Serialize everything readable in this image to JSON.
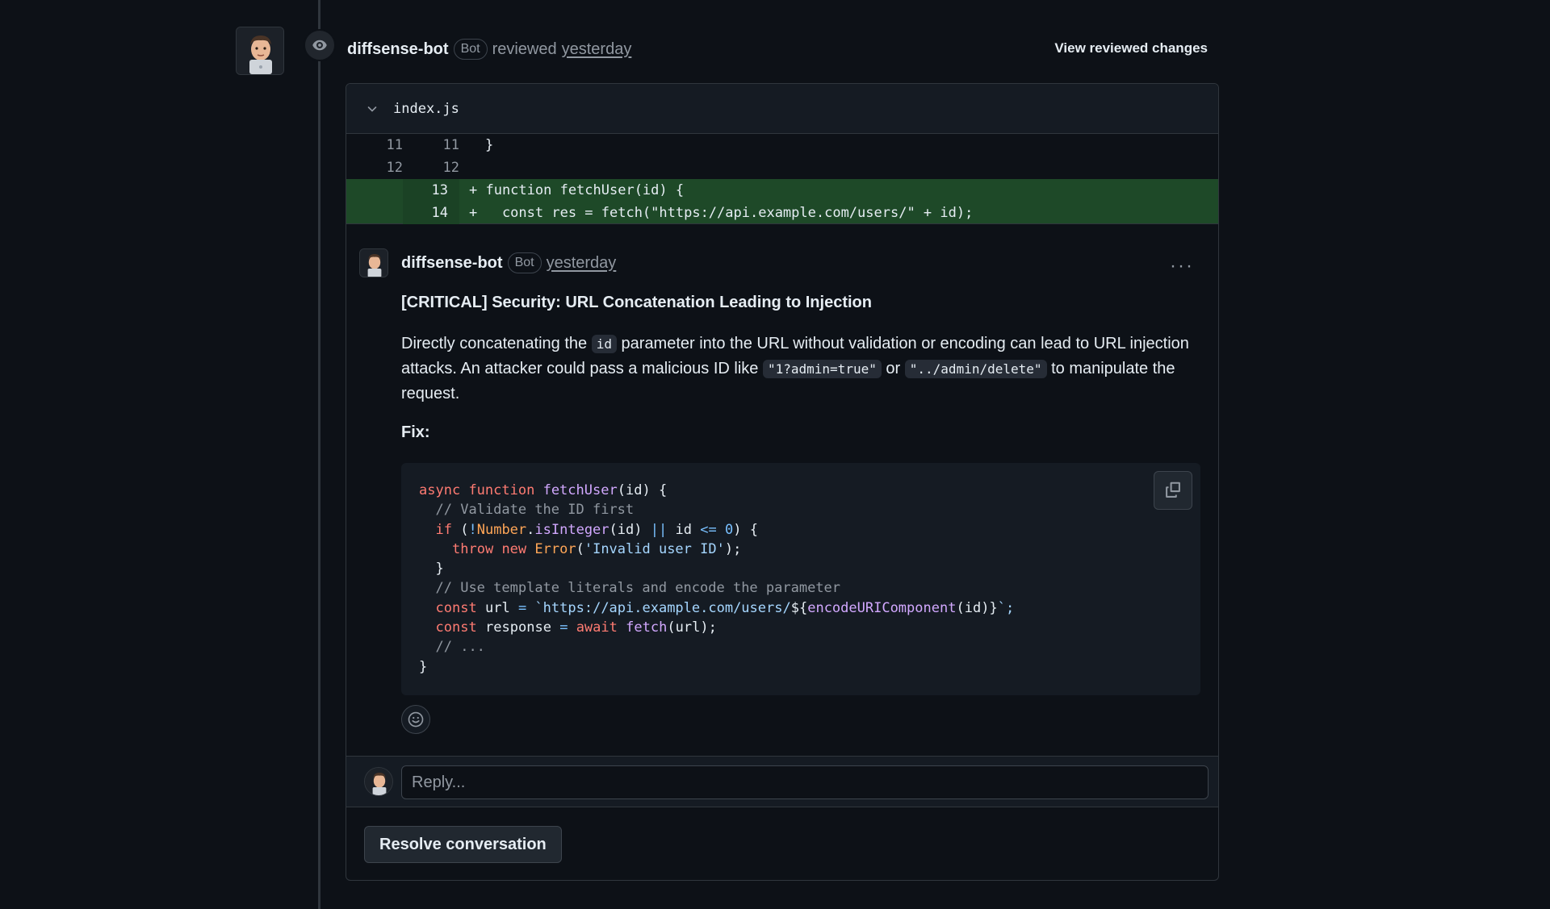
{
  "review": {
    "author": "diffsense-bot",
    "badge": "Bot",
    "action": "reviewed",
    "time": "yesterday",
    "view_changes_label": "View reviewed changes"
  },
  "file": {
    "name": "index.js",
    "diff": [
      {
        "old": "11",
        "new": "11",
        "code": "}",
        "added": false
      },
      {
        "old": "12",
        "new": "12",
        "code": "",
        "added": false
      },
      {
        "old": "",
        "new": "13",
        "code": "+ function fetchUser(id) {",
        "added": true
      },
      {
        "old": "",
        "new": "14",
        "code": "+   const res = fetch(\"https://api.example.com/users/\" + id);",
        "added": true
      }
    ]
  },
  "comment": {
    "author": "diffsense-bot",
    "badge": "Bot",
    "time": "yesterday",
    "menu": "···",
    "title": "[CRITICAL] Security: URL Concatenation Leading to Injection",
    "para_1": "Directly concatenating the",
    "code_1": "id",
    "para_2": "parameter into the URL without validation or encoding can lead to URL injection attacks. An attacker could pass a malicious ID like",
    "code_2": "\"1?admin=true\"",
    "para_3": "or",
    "code_3": "\"../admin/delete\"",
    "para_4": "to manipulate the request.",
    "fix_label": "Fix:",
    "code_lines": [
      "async function fetchUser(id) {",
      "  // Validate the ID first",
      "  if (!Number.isInteger(id) || id <= 0) {",
      "    throw new Error('Invalid user ID');",
      "  }",
      "  // Use template literals and encode the parameter",
      "  const url = `https://api.example.com/users/${encodeURIComponent(id)}`;",
      "  const response = await fetch(url);",
      "  // ...",
      "}"
    ]
  },
  "reply": {
    "placeholder": "Reply..."
  },
  "resolve_label": "Resolve conversation",
  "icons": {
    "eye": "eye-icon",
    "chevron": "chevron-down-icon",
    "copy": "copy-icon",
    "smiley": "smiley-icon",
    "avatar": "avatar"
  },
  "colors": {
    "background": "#0d1117",
    "added_line": "#1e4928",
    "keyword": "#ff7b72",
    "function": "#d2a8ff",
    "string": "#a5d6ff"
  }
}
